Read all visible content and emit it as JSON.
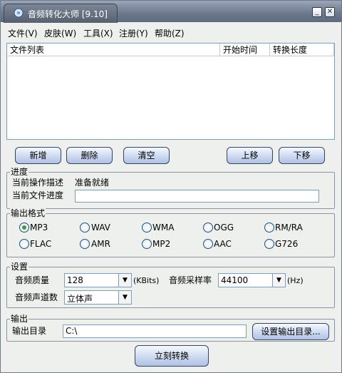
{
  "window": {
    "title": "音频转化大师 [9.10]",
    "minimize_icon": "minimize-icon",
    "close_icon": "close-icon"
  },
  "menu": [
    "文件(V)",
    "皮肤(W)",
    "工具(X)",
    "注册(Y)",
    "帮助(Z)"
  ],
  "file_list": {
    "columns": [
      "文件列表",
      "开始时间",
      "转换长度"
    ]
  },
  "buttons": {
    "add": "新增",
    "delete": "删除",
    "clear": "清空",
    "move_up": "上移",
    "move_down": "下移",
    "set_output_dir": "设置输出目录...",
    "convert_now": "立刻转换"
  },
  "progress": {
    "group": "进度",
    "op_label": "当前操作描述",
    "op_value": "准备就绪",
    "file_label": "当前文件进度"
  },
  "format": {
    "group": "输出格式",
    "options": [
      "MP3",
      "WAV",
      "WMA",
      "OGG",
      "RM/RA",
      "FLAC",
      "AMR",
      "MP2",
      "AAC",
      "G726"
    ],
    "selected": "MP3"
  },
  "settings": {
    "group": "设置",
    "quality_label": "音频质量",
    "quality_value": "128",
    "quality_unit": "(KBits)",
    "rate_label": "音频采样率",
    "rate_value": "44100",
    "rate_unit": "(Hz)",
    "channels_label": "音频声道数",
    "channels_value": "立体声"
  },
  "output": {
    "group": "输出",
    "dir_label": "输出目录",
    "dir_value": "C:\\"
  }
}
